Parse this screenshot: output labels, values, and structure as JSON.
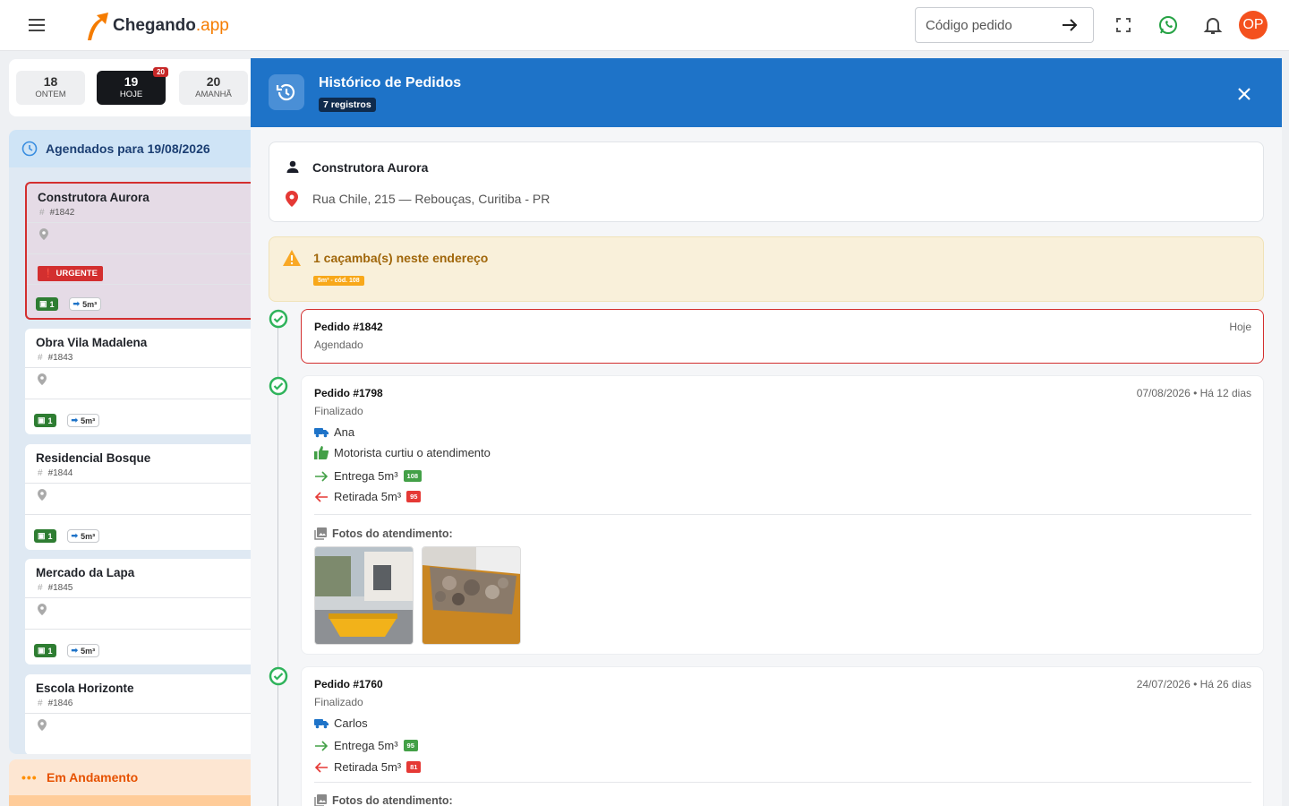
{
  "header": {
    "logo_main": "Chegando",
    "logo_suffix": ".app",
    "search_placeholder": "Código pedido",
    "avatar_initials": "OP"
  },
  "days": [
    {
      "num": "18",
      "label": "ONTEM",
      "active": false
    },
    {
      "num": "19",
      "label": "HOJE",
      "active": true,
      "badge": "20"
    },
    {
      "num": "20",
      "label": "AMANHÃ",
      "active": false
    }
  ],
  "scheduled": {
    "title": "Agendados para 19/08/2026",
    "orders": [
      {
        "name": "Construtora Aurora",
        "id": "#1842",
        "urgent_label": "URGENTE",
        "qty": "1",
        "size": "5m³"
      },
      {
        "name": "Obra Vila Madalena",
        "id": "#1843",
        "qty": "1",
        "size": "5m³"
      },
      {
        "name": "Residencial Bosque",
        "id": "#1844",
        "qty": "1",
        "size": "5m³"
      },
      {
        "name": "Mercado da Lapa",
        "id": "#1845",
        "qty": "1",
        "size": "5m³"
      },
      {
        "name": "Escola Horizonte",
        "id": "#1846"
      }
    ]
  },
  "in_progress": {
    "title": "Em Andamento"
  },
  "drawer": {
    "title": "Histórico de Pedidos",
    "count": "7 registros",
    "customer": {
      "name": "Construtora Aurora",
      "address": "Rua Chile, 215 — Rebouças, Curitiba - PR"
    },
    "warning": {
      "title": "1 caçamba(s) neste endereço",
      "chip": "5m³ - cód. 108"
    },
    "orders": [
      {
        "title": "Pedido #1842",
        "status": "Agendado",
        "date": "Hoje"
      },
      {
        "title": "Pedido #1798",
        "status": "Finalizado",
        "date": "07/08/2026 • Há 12 dias",
        "driver": "Ana",
        "feedback": "Motorista curtiu o atendimento",
        "delivery": "Entrega 5m³",
        "delivery_code": "108",
        "pickup": "Retirada 5m³",
        "pickup_code": "95",
        "photos_label": "Fotos do atendimento:"
      },
      {
        "title": "Pedido #1760",
        "status": "Finalizado",
        "date": "24/07/2026 • Há 26 dias",
        "driver": "Carlos",
        "delivery": "Entrega 5m³",
        "delivery_code": "95",
        "pickup": "Retirada 5m³",
        "pickup_code": "81",
        "photos_label": "Fotos do atendimento:"
      }
    ]
  },
  "colors": {
    "primary": "#1e73c8",
    "accent": "#f57c00",
    "danger": "#d32f2f",
    "success": "#43a047"
  }
}
